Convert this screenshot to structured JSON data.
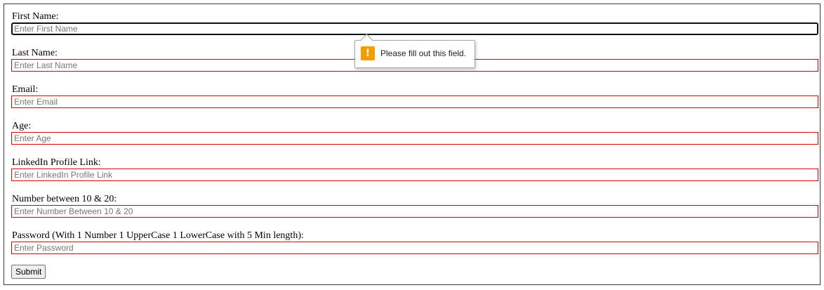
{
  "form": {
    "first_name": {
      "label": "First Name:",
      "placeholder": "Enter First Name",
      "value": ""
    },
    "last_name": {
      "label": "Last Name:",
      "placeholder": "Enter Last Name",
      "value": ""
    },
    "email": {
      "label": "Email:",
      "placeholder": "Enter Email",
      "value": ""
    },
    "age": {
      "label": "Age:",
      "placeholder": "Enter Age",
      "value": ""
    },
    "linkedin": {
      "label": "LinkedIn Profile Link:",
      "placeholder": "Enter LinkedIn Profile Link",
      "value": ""
    },
    "number": {
      "label": "Number between 10 & 20:",
      "placeholder": "Enter Number Between 10 & 20",
      "value": ""
    },
    "password": {
      "label": "Password (With 1 Number 1 UpperCase 1 LowerCase with 5 Min length):",
      "placeholder": "Enter Password",
      "value": ""
    },
    "submit_label": "Submit"
  },
  "validation_tooltip": {
    "message": "Please fill out this field.",
    "icon": "warning-icon",
    "icon_glyph": "!",
    "icon_color": "#f59c00"
  },
  "colors": {
    "invalid_border": "#e00000",
    "focused_border": "#101010"
  }
}
